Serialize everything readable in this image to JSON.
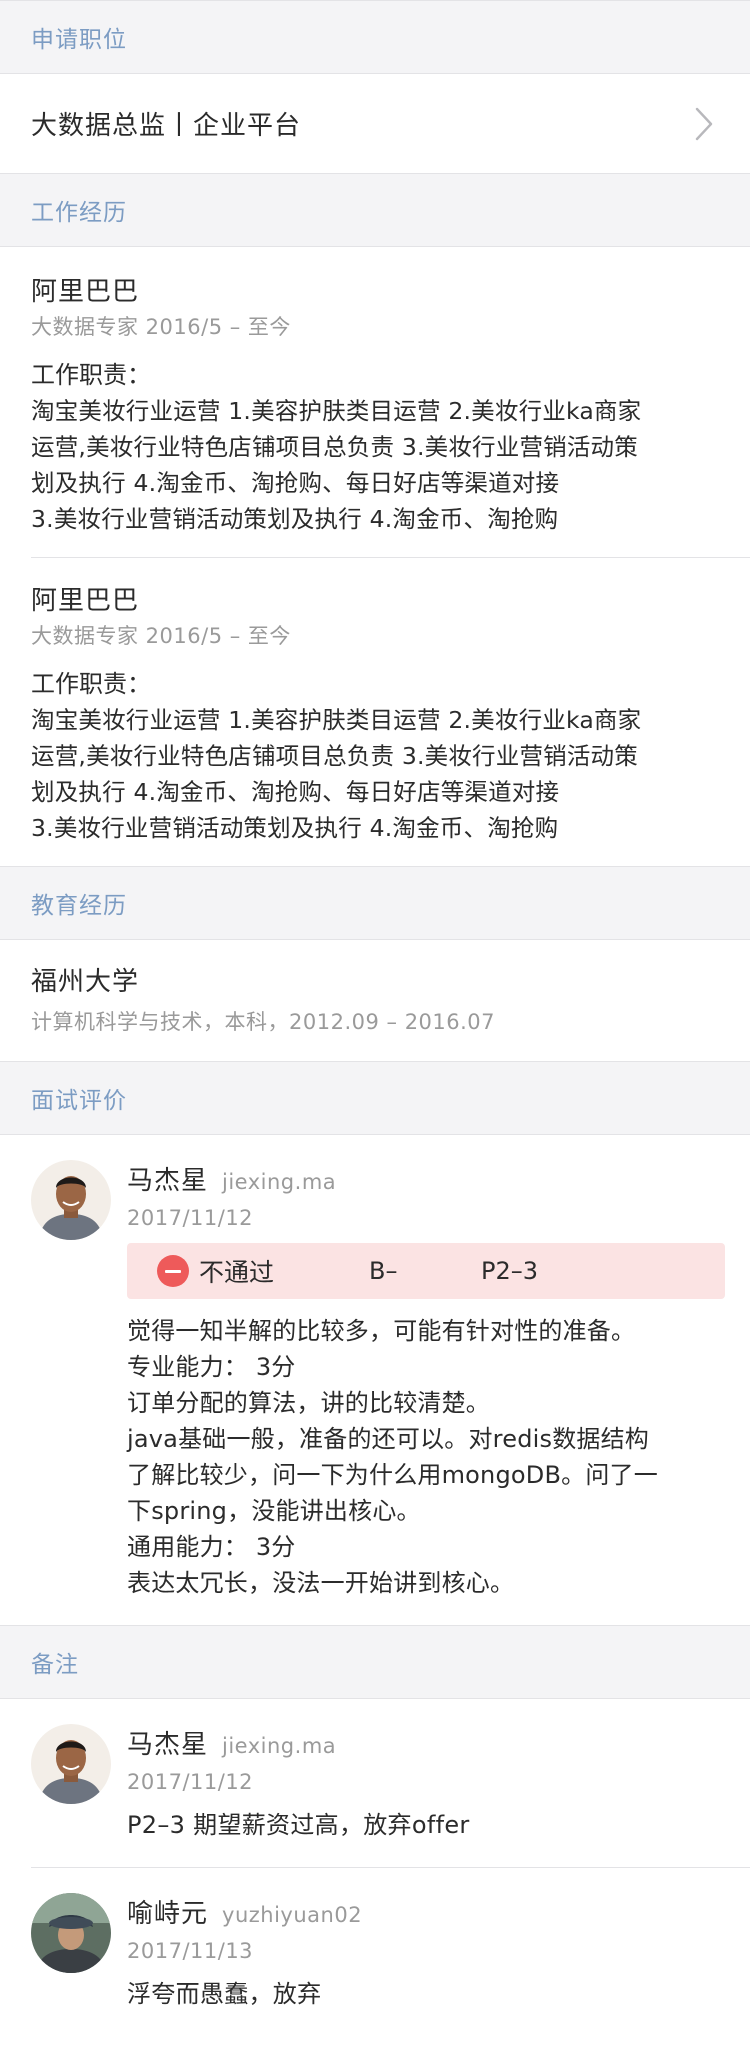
{
  "sections": {
    "position": "申请职位",
    "work": "工作经历",
    "education": "教育经历",
    "review": "面试评价",
    "notes": "备注"
  },
  "position": {
    "value": "大数据总监丨企业平台"
  },
  "work": [
    {
      "company": "阿里巴巴",
      "role_period": "大数据专家  2016/5 – 至今",
      "duty_title": "工作职责：",
      "duty_lines": [
        "淘宝美妆行业运营 1.美容护肤类目运营 2.美妆行业ka商家",
        "运营,美妆行业特色店铺项目总负责 3.美妆行业营销活动策",
        "划及执行 4.淘金币、淘抢购、每日好店等渠道对接",
        "3.美妆行业营销活动策划及执行 4.淘金币、淘抢购"
      ]
    },
    {
      "company": "阿里巴巴",
      "role_period": "大数据专家  2016/5 – 至今",
      "duty_title": "工作职责：",
      "duty_lines": [
        "淘宝美妆行业运营 1.美容护肤类目运营 2.美妆行业ka商家",
        "运营,美妆行业特色店铺项目总负责 3.美妆行业营销活动策",
        "划及执行 4.淘金币、淘抢购、每日好店等渠道对接",
        "3.美妆行业营销活动策划及执行 4.淘金币、淘抢购"
      ]
    }
  ],
  "education": {
    "school": "福州大学",
    "detail": "计算机科学与技术，本科，2012.09 – 2016.07"
  },
  "review": {
    "name": "马杰星",
    "id": "jiexing.ma",
    "date": "2017/11/12",
    "verdict": "不通过",
    "grade": "B–",
    "level": "P2–3",
    "lines": [
      "觉得一知半解的比较多，可能有针对性的准备。",
      "专业能力：  3分",
      "订单分配的算法，讲的比较清楚。",
      "java基础一般，准备的还可以。对redis数据结构",
      "了解比较少，问一下为什么用mongoDB。问了一",
      "下spring，没能讲出核心。",
      "通用能力：  3分",
      "表达太冗长，没法一开始讲到核心。"
    ]
  },
  "notes": [
    {
      "name": "马杰星",
      "id": "jiexing.ma",
      "date": "2017/11/12",
      "text": "P2–3 期望薪资过高，放弃offer"
    },
    {
      "name": "喻峙元",
      "id": "yuzhiyuan02",
      "date": "2017/11/13",
      "text": "浮夸而愚蠢，放弃"
    }
  ],
  "icons": {
    "chevron": "chevron-right-icon",
    "verdict": "minus-circle-icon"
  },
  "colors": {
    "section_label": "#7c9cc3",
    "verdict_bg": "#fbe3e3",
    "verdict_icon": "#ee5a5a"
  }
}
